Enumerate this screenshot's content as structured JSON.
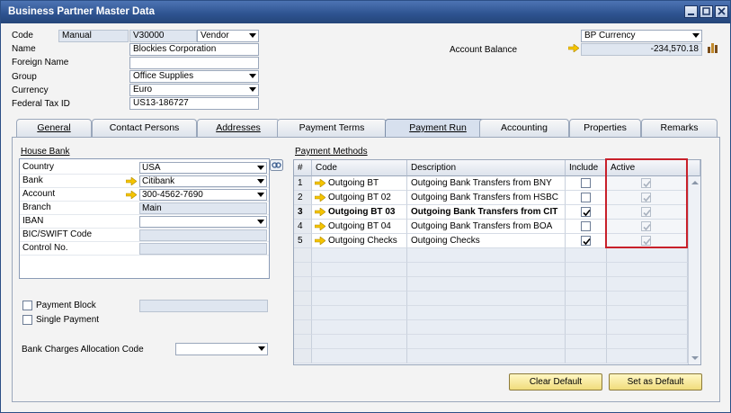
{
  "window": {
    "title": "Business Partner Master Data"
  },
  "header": {
    "code_label": "Code",
    "code_series": "Manual",
    "code_value": "V30000",
    "type_value": "Vendor",
    "name_label": "Name",
    "name_value": "Blockies Corporation",
    "foreign_name_label": "Foreign Name",
    "foreign_name_value": "",
    "group_label": "Group",
    "group_value": "Office Supplies",
    "currency_label": "Currency",
    "currency_value": "Euro",
    "tax_id_label": "Federal Tax ID",
    "tax_id_value": "US13-186727",
    "bp_currency_value": "BP Currency",
    "balance_label": "Account Balance",
    "balance_value": "-234,570.18"
  },
  "tabs": [
    "General",
    "Contact Persons",
    "Addresses",
    "Payment Terms",
    "Payment Run",
    "Accounting",
    "Properties",
    "Remarks"
  ],
  "active_tab": "Payment Run",
  "house_bank": {
    "title": "House Bank",
    "rows": [
      {
        "label": "Country",
        "value": "USA"
      },
      {
        "label": "Bank",
        "value": "Citibank"
      },
      {
        "label": "Account",
        "value": "300-4562-7690"
      },
      {
        "label": "Branch",
        "value": "Main"
      },
      {
        "label": "IBAN",
        "value": ""
      },
      {
        "label": "BIC/SWIFT Code",
        "value": ""
      },
      {
        "label": "Control No.",
        "value": ""
      }
    ]
  },
  "payment_block_label": "Payment Block",
  "single_payment_label": "Single Payment",
  "bank_charges_label": "Bank Charges Allocation Code",
  "payment_methods": {
    "title": "Payment Methods",
    "columns": [
      "#",
      "Code",
      "Description",
      "Include",
      "Active"
    ],
    "rows": [
      {
        "num": "1",
        "code": "Outgoing BT",
        "description": "Outgoing Bank Transfers from BNY",
        "include": false,
        "active": true,
        "bold": false
      },
      {
        "num": "2",
        "code": "Outgoing BT 02",
        "description": "Outgoing Bank Transfers from HSBC",
        "include": false,
        "active": true,
        "bold": false
      },
      {
        "num": "3",
        "code": "Outgoing BT 03",
        "description": "Outgoing Bank Transfers from CIT",
        "include": true,
        "active": true,
        "bold": true
      },
      {
        "num": "4",
        "code": "Outgoing BT 04",
        "description": "Outgoing Bank Transfers from BOA",
        "include": false,
        "active": true,
        "bold": false
      },
      {
        "num": "5",
        "code": "Outgoing Checks",
        "description": "Outgoing Checks",
        "include": true,
        "active": true,
        "bold": false
      }
    ]
  },
  "buttons": {
    "clear_default": "Clear Default",
    "set_as_default": "Set as Default"
  },
  "colors": {
    "accent": "#2d528f",
    "highlight": "#c8202a",
    "arrow": "#f5c400"
  }
}
